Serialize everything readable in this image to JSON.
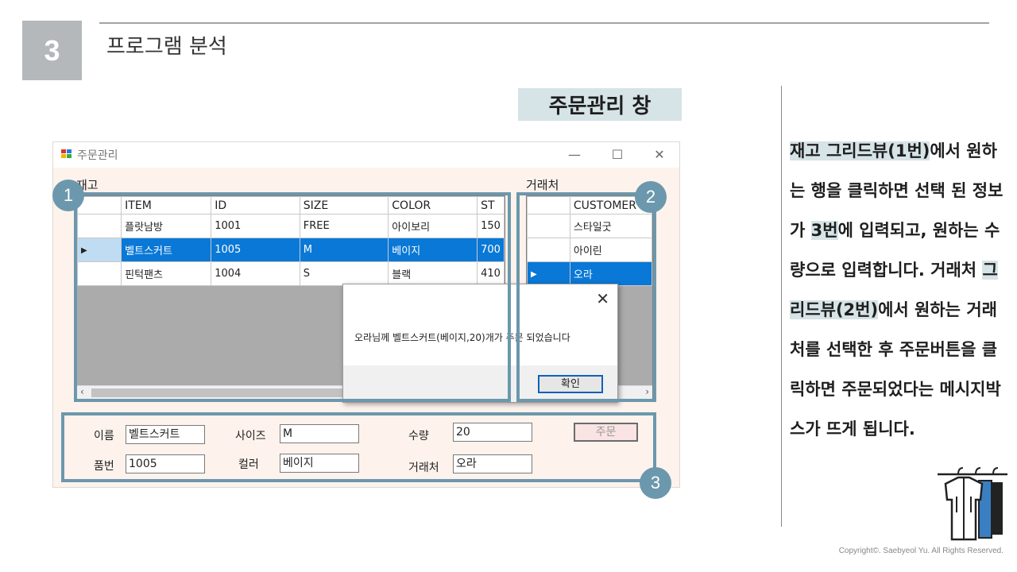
{
  "slide": {
    "section_number": "3",
    "section_title": "프로그램 분석",
    "window_tag": "주문관리 창",
    "copyright": "Copyright©. Saebyeol Yu. All Rights Reserved."
  },
  "window": {
    "title": "주문관리",
    "minimize": "—",
    "maximize": "☐",
    "close": "✕"
  },
  "inventory": {
    "label": "재고",
    "columns": [
      "ITEM",
      "ID",
      "SIZE",
      "COLOR",
      "ST"
    ],
    "rows": [
      {
        "item": "플랏남방",
        "id": "1001",
        "size": "FREE",
        "color": "아이보리",
        "st": "150"
      },
      {
        "item": "벨트스커트",
        "id": "1005",
        "size": "M",
        "color": "베이지",
        "st": "700"
      },
      {
        "item": "핀턱팬츠",
        "id": "1004",
        "size": "S",
        "color": "블랙",
        "st": "410"
      }
    ],
    "selected_row": 1
  },
  "customers": {
    "label": "거래처",
    "column": "CUSTOMER",
    "rows": [
      "스타일굿",
      "아이린",
      "오라"
    ],
    "selected_row": 2
  },
  "form": {
    "name_label": "이름",
    "name_value": "벨트스커트",
    "id_label": "품번",
    "id_value": "1005",
    "size_label": "사이즈",
    "size_value": "M",
    "color_label": "컬러",
    "color_value": "베이지",
    "qty_label": "수량",
    "qty_value": "20",
    "customer_label": "거래처",
    "customer_value": "오라",
    "order_button": "주문"
  },
  "message_box": {
    "text": "오라님께 벨트스커트(베이지,20)개가 주문 되었습니다",
    "ok": "확인",
    "close": "✕"
  },
  "badges": [
    "1",
    "2",
    "3"
  ],
  "description": {
    "parts": [
      {
        "text": "재고 그리드뷰(1번)",
        "hl": true
      },
      {
        "text": "에서 원하는 행을 클릭하면 선택 된 정보가 ",
        "hl": false
      },
      {
        "text": "3번",
        "hl": true
      },
      {
        "text": "에 입력되고, 원하는 수량으로 입력합니다. 거래처 ",
        "hl": false
      },
      {
        "text": "그리드뷰(2번)",
        "hl": true
      },
      {
        "text": "에서 원하는 거래처를 선택한 후 주문버튼을 클릭하면 주문되었다는 메시지박스가 뜨게 됩니다.",
        "hl": false
      }
    ]
  },
  "colors": {
    "accent": "#6b98ac",
    "highlight": "#d6e3e7",
    "selection": "#0a78d7"
  }
}
